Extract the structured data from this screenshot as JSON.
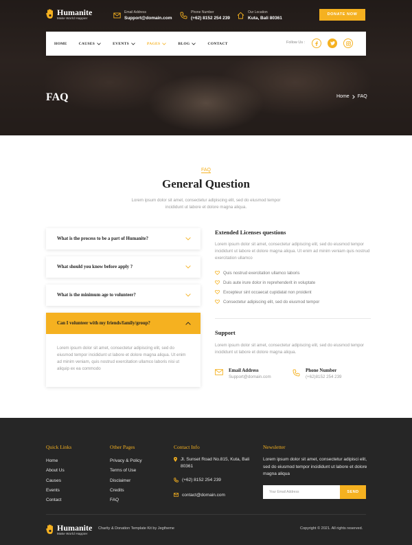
{
  "brand": {
    "name": "Humanite",
    "tagline": "Make World Happier"
  },
  "header": {
    "email": {
      "label": "Email Address",
      "value": "Support@domain.com"
    },
    "phone": {
      "label": "Phone Number",
      "value": "(+62) 8152 254 239"
    },
    "location": {
      "label": "Our Location",
      "value": "Kuta, Bali 80361"
    },
    "donate_label": "DONATE NOW"
  },
  "nav": {
    "items": [
      {
        "label": "HOME",
        "has_dropdown": false,
        "active": false
      },
      {
        "label": "CAUSES",
        "has_dropdown": true,
        "active": false
      },
      {
        "label": "EVENTS",
        "has_dropdown": true,
        "active": false
      },
      {
        "label": "PAGES",
        "has_dropdown": true,
        "active": true
      },
      {
        "label": "BLOG",
        "has_dropdown": true,
        "active": false
      },
      {
        "label": "CONTACT",
        "has_dropdown": false,
        "active": false
      }
    ],
    "follow_label": "Follow Us :",
    "social": [
      "facebook-icon",
      "twitter-icon",
      "instagram-icon"
    ]
  },
  "hero": {
    "title": "FAQ",
    "breadcrumb": [
      "Home",
      "FAQ"
    ]
  },
  "faq": {
    "eyebrow": "FAQ",
    "heading": "General Question",
    "intro": "Lorem ipsum dolor sit amet, consectetur adipiscing elit, sed do eiusmod tempor incididunt ut labore et dolore magna aliqua.",
    "questions": [
      {
        "q": "What is the process to be a part of Humanite?",
        "open": false
      },
      {
        "q": "What should you know before apply ?",
        "open": false
      },
      {
        "q": "What is the minimum age to volunteer?",
        "open": false
      },
      {
        "q": "Can I volunteer with my friends/family/group?",
        "open": true,
        "a": "Lorem ipsum dolor sit amet, consectetur adipiscing elit, sed do eiusmod tempor incididunt ut labore et dolore magna aliqua. Ut enim ad minim veniam, quis nostrud exercitation ullamco laboris nisi ut aliquip ex ea commodo"
      }
    ]
  },
  "licenses": {
    "heading": "Extended Licenses questions",
    "text": "Lorem ipsum dolor sit amet, consectetur adipiscing elit, sed do eiusmod tempor incididunt ut labore et dolore magna aliqua. Ut enim ad minim veniam quis nostrud exercitation ullamco",
    "points": [
      "Quis nostrud exercitation ullamco laboris",
      "Duis aute irure dolor in reprehenderit in voluptate",
      "Excepteur sint occaecat cupidatat non proident",
      "Consectetur adipiscing elit, sed do eiusmod tempor"
    ]
  },
  "support": {
    "heading": "Support",
    "text": "Lorem ipsum dolor sit amet, consectetur adipiscing elit, sed do eiusmod tempor incididunt ut labore et dolore magna aliqua.",
    "email": {
      "title": "Email Address",
      "value": "Support@domain.com"
    },
    "phone": {
      "title": "Phone Number",
      "value": "(+62)8152 254 239"
    }
  },
  "footer": {
    "quick_links": {
      "heading": "Quick Links",
      "items": [
        "Home",
        "About Us",
        "Causes",
        "Events",
        "Contact"
      ]
    },
    "other_pages": {
      "heading": "Other Pages",
      "items": [
        "Privacy & Policy",
        "Terms of Use",
        "Disclaimer",
        "Credits",
        "FAQ"
      ]
    },
    "contact": {
      "heading": "Contact Info",
      "address": "Jl. Sunset Road No.815, Kuta, Bali 80361",
      "phone": "(+62) 8152 254 239",
      "email": "contact@domain.com"
    },
    "newsletter": {
      "heading": "Newsletter",
      "text": "Lorem ipsum dolor sit amet, consectetur adipisci elit, sed do eiusmod tempor incididunt ut labore et dolore magna aliqua",
      "placeholder": "Your Email Address",
      "button": "SEND"
    },
    "credit": "Charity & Donation Template Kit by Jegtheme",
    "copyright": "Copyright © 2021. All rights reserved."
  },
  "colors": {
    "accent": "#f5b120",
    "footer_bg": "#262626",
    "text_dark": "#222222",
    "text_muted": "#999999"
  }
}
